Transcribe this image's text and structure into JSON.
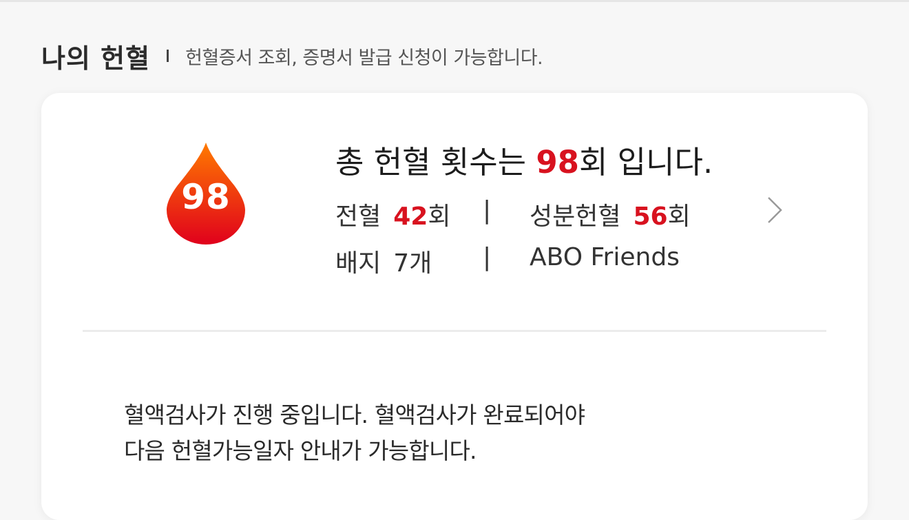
{
  "header": {
    "title": "나의 헌혈",
    "description": "헌혈증서 조회, 증명서 발급 신청이 가능합니다."
  },
  "card": {
    "drop_count": "98",
    "summary": {
      "prefix": "총 헌혈 횟수는 ",
      "count": "98",
      "suffix": "회 입니다."
    },
    "whole_blood": {
      "label": "전혈",
      "count": "42",
      "unit": "회"
    },
    "component": {
      "label": "성분헌혈",
      "count": "56",
      "unit": "회"
    },
    "badges": {
      "label": "배지",
      "value": "7개"
    },
    "club": "ABO Friends",
    "separator": "|",
    "notice_lines": [
      "혈액검사가 진행 중입니다. 혈액검사가 완료되어야",
      "다음 헌혈가능일자 안내가 가능합니다."
    ]
  },
  "colors": {
    "accent": "#d8121f",
    "drop_top": "#ff7a00",
    "drop_bottom": "#e0001c"
  },
  "icons": {
    "drop": "blood-drop-icon",
    "detail": "chevron-right-icon"
  }
}
